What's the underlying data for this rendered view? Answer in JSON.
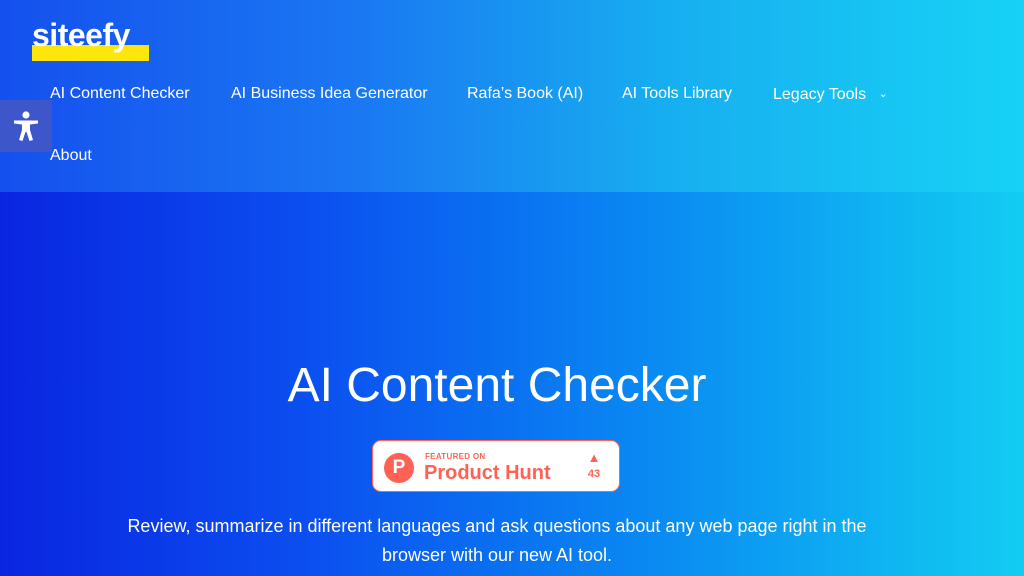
{
  "header": {
    "logo_text": "siteefy",
    "nav": [
      {
        "label": "AI Content Checker"
      },
      {
        "label": "AI Business Idea Generator"
      },
      {
        "label": "Rafa’s Book (AI)"
      },
      {
        "label": "AI Tools Library"
      },
      {
        "label": "Legacy Tools",
        "has_dropdown": true
      },
      {
        "label": "About"
      }
    ]
  },
  "accessibility": {
    "icon": "accessibility-icon"
  },
  "hero": {
    "title": "AI Content Checker",
    "badge": {
      "featured": "FEATURED ON",
      "name": "Product Hunt",
      "logo_letter": "P",
      "upvote_icon": "▲",
      "count": "43"
    },
    "description": "Review, summarize in different languages and ask questions about any web page right in the browser with our new AI tool."
  },
  "colors": {
    "logo_underline": "#fde60b",
    "product_hunt": "#ff6154",
    "a11y_button": "#3d56c9"
  }
}
